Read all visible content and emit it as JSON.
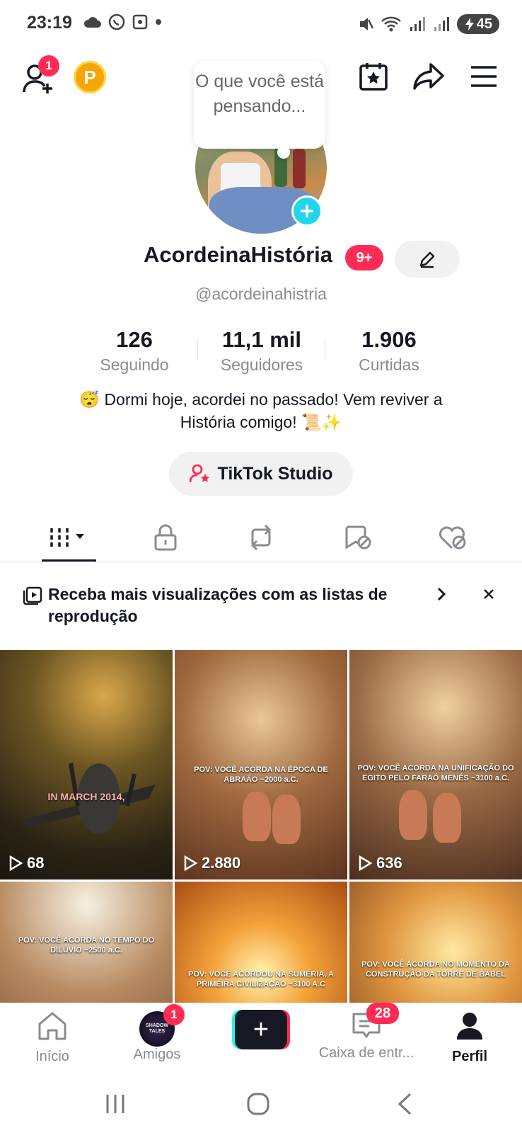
{
  "status_bar": {
    "time": "23:19",
    "battery": "45"
  },
  "header": {
    "add_friends_badge": "1",
    "coin_label": "P",
    "bubble_text": "O que você está pensando..."
  },
  "profile": {
    "display_name": "AcordeinaHistória",
    "notification_badge": "9+",
    "handle": "@acordeinahistria",
    "stats": [
      {
        "value": "126",
        "label": "Seguindo"
      },
      {
        "value": "11,1 mil",
        "label": "Seguidores"
      },
      {
        "value": "1.906",
        "label": "Curtidas"
      }
    ],
    "bio_line1": "😴 Dormi hoje, acordei no passado! Vem reviver a",
    "bio_line2": "História comigo! 📜✨",
    "studio_label": "TikTok Studio"
  },
  "promo": {
    "text": "Receba mais visualizações com as listas de reprodução"
  },
  "videos": [
    {
      "caption": "IN MARCH 2014,",
      "views": "68"
    },
    {
      "caption": "POV: VOCÊ ACORDA NA ÉPOCA DE ABRAÃO ~2000 a.C.",
      "views": "2.880"
    },
    {
      "caption": "POV: VOCÊ ACORDA NA UNIFICAÇÃO DO EGITO PELO FARAÓ MENÉS ~3100 a.C.",
      "views": "636"
    },
    {
      "caption": "POV: VOCÊ ACORDA NO TEMPO DO DILÚVIO ~2500 a.C.",
      "views": ""
    },
    {
      "caption": "POV: VOCÊ ACORDOU NA SUMÉRIA, A PRIMEIRA CIVILIZAÇÃO ~3100 A.C",
      "views": ""
    },
    {
      "caption": "POV: VOCÊ ACORDA NO MOMENTO DA CONSTRUÇÃO DA TORRE DE BABEL",
      "views": ""
    }
  ],
  "bottom_nav": {
    "home": "Início",
    "friends": "Amigos",
    "friends_badge": "1",
    "friends_avatar_text": "SHADOW TALES",
    "inbox": "Caixa de entr...",
    "inbox_badge": "28",
    "profile": "Perfil"
  },
  "colors": {
    "accent": "#fe2c55",
    "cyan": "#20d5ec",
    "text": "#161823",
    "muted": "#8a8b91"
  }
}
